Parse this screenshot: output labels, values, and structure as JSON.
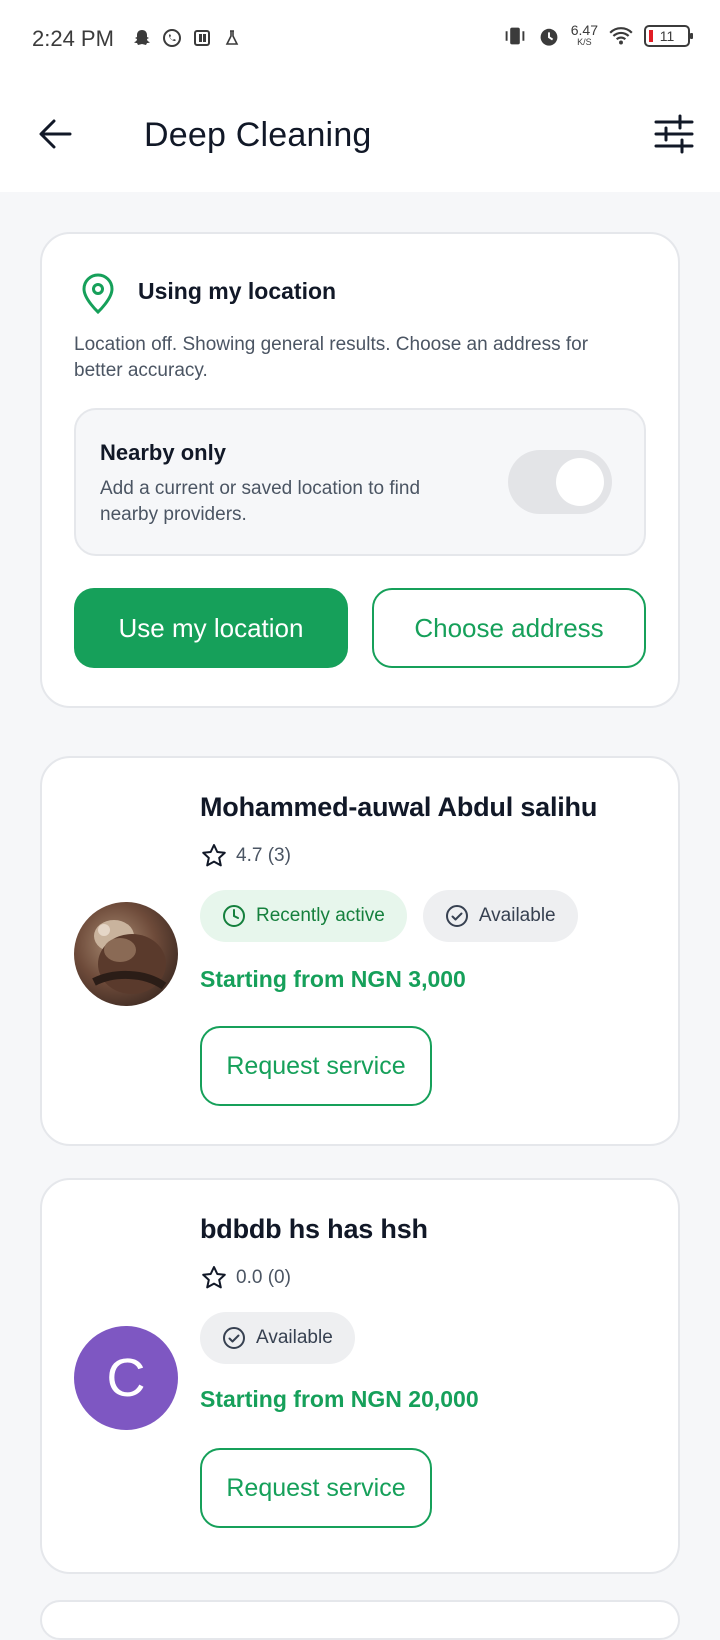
{
  "status_bar": {
    "time": "2:24 PM",
    "net_speed_value": "6.47",
    "net_speed_unit": "K/S",
    "battery": "11",
    "left_icons": [
      "snapchat-icon",
      "whatsapp-icon",
      "app-icon",
      "flask-icon"
    ],
    "right_icons": [
      "vibrate-icon",
      "alarm-icon",
      "wifi-icon",
      "battery-icon"
    ]
  },
  "app_bar": {
    "title": "Deep Cleaning",
    "back_icon": "back-arrow-icon",
    "filter_icon": "sliders-icon"
  },
  "location_card": {
    "title": "Using my location",
    "description": "Location off. Showing general results. Choose an address for better accuracy.",
    "nearby": {
      "title": "Nearby only",
      "description": "Add a current or saved location to find nearby providers.",
      "toggle_on": false
    },
    "use_location_label": "Use my location",
    "choose_address_label": "Choose address"
  },
  "providers": [
    {
      "name": "Mohammed-auwal Abdul salihu",
      "rating": "4.7 (3)",
      "badges": [
        "Recently active",
        "Available"
      ],
      "price": "Starting from NGN 3,000",
      "request_label": "Request service",
      "avatar": "photo"
    },
    {
      "name": "bdbdb hs has hsh",
      "rating": "0.0 (0)",
      "badges": [
        "Available"
      ],
      "price": "Starting from NGN 20,000",
      "request_label": "Request service",
      "avatar_letter": "C",
      "avatar_color": "#7e57c2"
    }
  ],
  "colors": {
    "accent": "#16a05a",
    "background": "#f6f7f9"
  }
}
